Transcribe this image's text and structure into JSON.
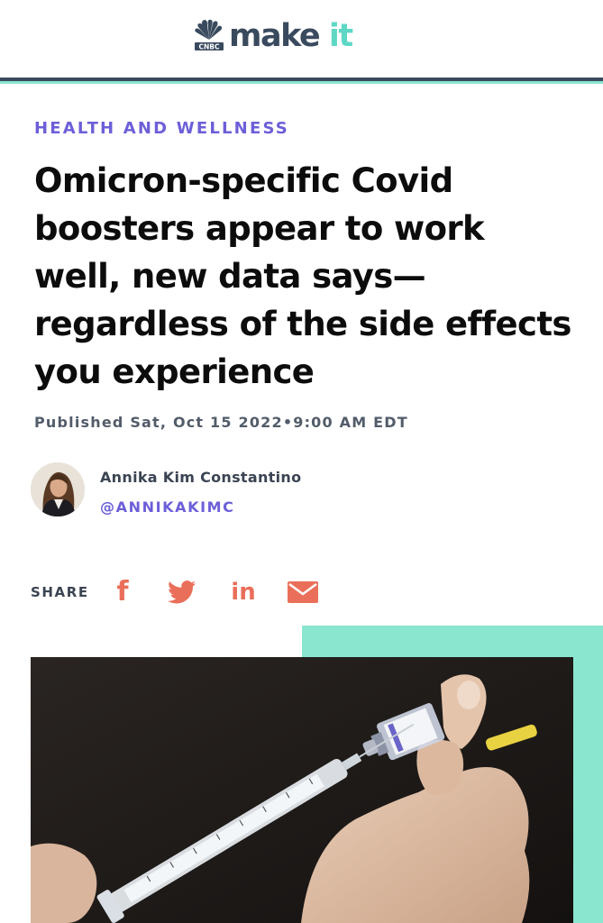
{
  "header": {
    "brand_small": "CNBC",
    "brand_main": "make ",
    "brand_accent": "it"
  },
  "article": {
    "category": "HEALTH AND WELLNESS",
    "headline": "Omicron-specific Covid boosters appear to work well, new data says— regardless of the side effects you experience",
    "published": "Published Sat, Oct 15 2022•9:00 AM EDT"
  },
  "author": {
    "name": "Annika Kim Constantino",
    "handle": "@ANNIKAKIMC"
  },
  "share": {
    "label": "SHARE",
    "facebook": "f",
    "linkedin": "in",
    "icons": [
      "facebook-icon",
      "twitter-icon",
      "linkedin-icon",
      "email-icon"
    ]
  },
  "colors": {
    "accent_purple": "#6c5fd8",
    "share_coral": "#ea6f5a",
    "teal": "#8be6cf",
    "navy": "#3a4a5e"
  }
}
